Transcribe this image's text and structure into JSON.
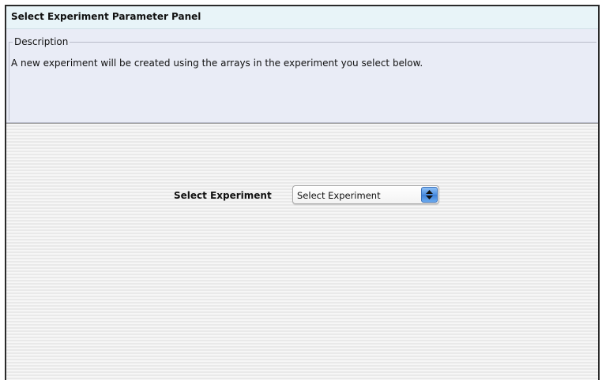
{
  "panel": {
    "title": "Select Experiment Parameter Panel"
  },
  "description": {
    "legend": "Description",
    "text": "A new experiment will be created using the arrays in the experiment you select below."
  },
  "form": {
    "select_label": "Select Experiment",
    "select_value": "Select Experiment"
  },
  "colors": {
    "title_bar_bg": "#e8f4f8",
    "description_bg": "#e9ecf6",
    "dropdown_arrow_accent": "#4d8fe0"
  }
}
